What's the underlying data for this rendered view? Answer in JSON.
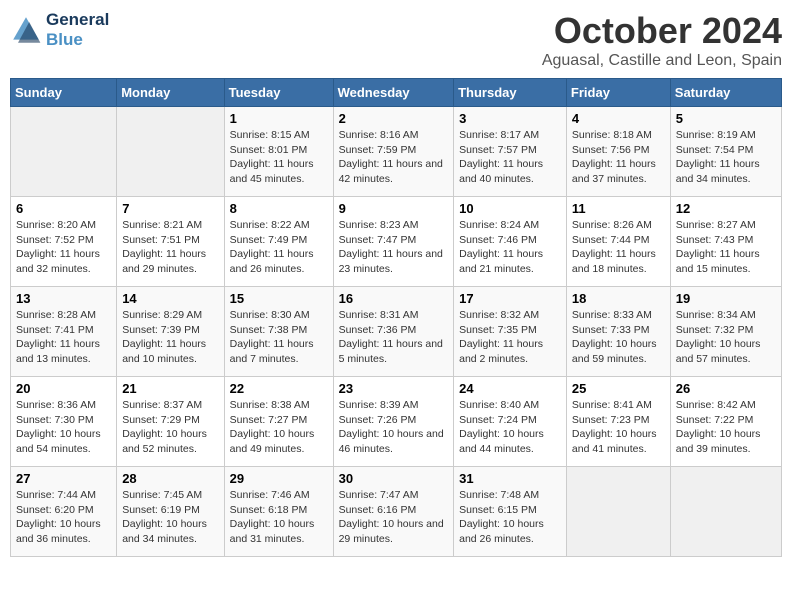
{
  "header": {
    "logo_line1": "General",
    "logo_line2": "Blue",
    "month": "October 2024",
    "location": "Aguasal, Castille and Leon, Spain"
  },
  "days_of_week": [
    "Sunday",
    "Monday",
    "Tuesday",
    "Wednesday",
    "Thursday",
    "Friday",
    "Saturday"
  ],
  "weeks": [
    [
      {
        "num": "",
        "detail": ""
      },
      {
        "num": "",
        "detail": ""
      },
      {
        "num": "1",
        "detail": "Sunrise: 8:15 AM\nSunset: 8:01 PM\nDaylight: 11 hours and 45 minutes."
      },
      {
        "num": "2",
        "detail": "Sunrise: 8:16 AM\nSunset: 7:59 PM\nDaylight: 11 hours and 42 minutes."
      },
      {
        "num": "3",
        "detail": "Sunrise: 8:17 AM\nSunset: 7:57 PM\nDaylight: 11 hours and 40 minutes."
      },
      {
        "num": "4",
        "detail": "Sunrise: 8:18 AM\nSunset: 7:56 PM\nDaylight: 11 hours and 37 minutes."
      },
      {
        "num": "5",
        "detail": "Sunrise: 8:19 AM\nSunset: 7:54 PM\nDaylight: 11 hours and 34 minutes."
      }
    ],
    [
      {
        "num": "6",
        "detail": "Sunrise: 8:20 AM\nSunset: 7:52 PM\nDaylight: 11 hours and 32 minutes."
      },
      {
        "num": "7",
        "detail": "Sunrise: 8:21 AM\nSunset: 7:51 PM\nDaylight: 11 hours and 29 minutes."
      },
      {
        "num": "8",
        "detail": "Sunrise: 8:22 AM\nSunset: 7:49 PM\nDaylight: 11 hours and 26 minutes."
      },
      {
        "num": "9",
        "detail": "Sunrise: 8:23 AM\nSunset: 7:47 PM\nDaylight: 11 hours and 23 minutes."
      },
      {
        "num": "10",
        "detail": "Sunrise: 8:24 AM\nSunset: 7:46 PM\nDaylight: 11 hours and 21 minutes."
      },
      {
        "num": "11",
        "detail": "Sunrise: 8:26 AM\nSunset: 7:44 PM\nDaylight: 11 hours and 18 minutes."
      },
      {
        "num": "12",
        "detail": "Sunrise: 8:27 AM\nSunset: 7:43 PM\nDaylight: 11 hours and 15 minutes."
      }
    ],
    [
      {
        "num": "13",
        "detail": "Sunrise: 8:28 AM\nSunset: 7:41 PM\nDaylight: 11 hours and 13 minutes."
      },
      {
        "num": "14",
        "detail": "Sunrise: 8:29 AM\nSunset: 7:39 PM\nDaylight: 11 hours and 10 minutes."
      },
      {
        "num": "15",
        "detail": "Sunrise: 8:30 AM\nSunset: 7:38 PM\nDaylight: 11 hours and 7 minutes."
      },
      {
        "num": "16",
        "detail": "Sunrise: 8:31 AM\nSunset: 7:36 PM\nDaylight: 11 hours and 5 minutes."
      },
      {
        "num": "17",
        "detail": "Sunrise: 8:32 AM\nSunset: 7:35 PM\nDaylight: 11 hours and 2 minutes."
      },
      {
        "num": "18",
        "detail": "Sunrise: 8:33 AM\nSunset: 7:33 PM\nDaylight: 10 hours and 59 minutes."
      },
      {
        "num": "19",
        "detail": "Sunrise: 8:34 AM\nSunset: 7:32 PM\nDaylight: 10 hours and 57 minutes."
      }
    ],
    [
      {
        "num": "20",
        "detail": "Sunrise: 8:36 AM\nSunset: 7:30 PM\nDaylight: 10 hours and 54 minutes."
      },
      {
        "num": "21",
        "detail": "Sunrise: 8:37 AM\nSunset: 7:29 PM\nDaylight: 10 hours and 52 minutes."
      },
      {
        "num": "22",
        "detail": "Sunrise: 8:38 AM\nSunset: 7:27 PM\nDaylight: 10 hours and 49 minutes."
      },
      {
        "num": "23",
        "detail": "Sunrise: 8:39 AM\nSunset: 7:26 PM\nDaylight: 10 hours and 46 minutes."
      },
      {
        "num": "24",
        "detail": "Sunrise: 8:40 AM\nSunset: 7:24 PM\nDaylight: 10 hours and 44 minutes."
      },
      {
        "num": "25",
        "detail": "Sunrise: 8:41 AM\nSunset: 7:23 PM\nDaylight: 10 hours and 41 minutes."
      },
      {
        "num": "26",
        "detail": "Sunrise: 8:42 AM\nSunset: 7:22 PM\nDaylight: 10 hours and 39 minutes."
      }
    ],
    [
      {
        "num": "27",
        "detail": "Sunrise: 7:44 AM\nSunset: 6:20 PM\nDaylight: 10 hours and 36 minutes."
      },
      {
        "num": "28",
        "detail": "Sunrise: 7:45 AM\nSunset: 6:19 PM\nDaylight: 10 hours and 34 minutes."
      },
      {
        "num": "29",
        "detail": "Sunrise: 7:46 AM\nSunset: 6:18 PM\nDaylight: 10 hours and 31 minutes."
      },
      {
        "num": "30",
        "detail": "Sunrise: 7:47 AM\nSunset: 6:16 PM\nDaylight: 10 hours and 29 minutes."
      },
      {
        "num": "31",
        "detail": "Sunrise: 7:48 AM\nSunset: 6:15 PM\nDaylight: 10 hours and 26 minutes."
      },
      {
        "num": "",
        "detail": ""
      },
      {
        "num": "",
        "detail": ""
      }
    ]
  ]
}
